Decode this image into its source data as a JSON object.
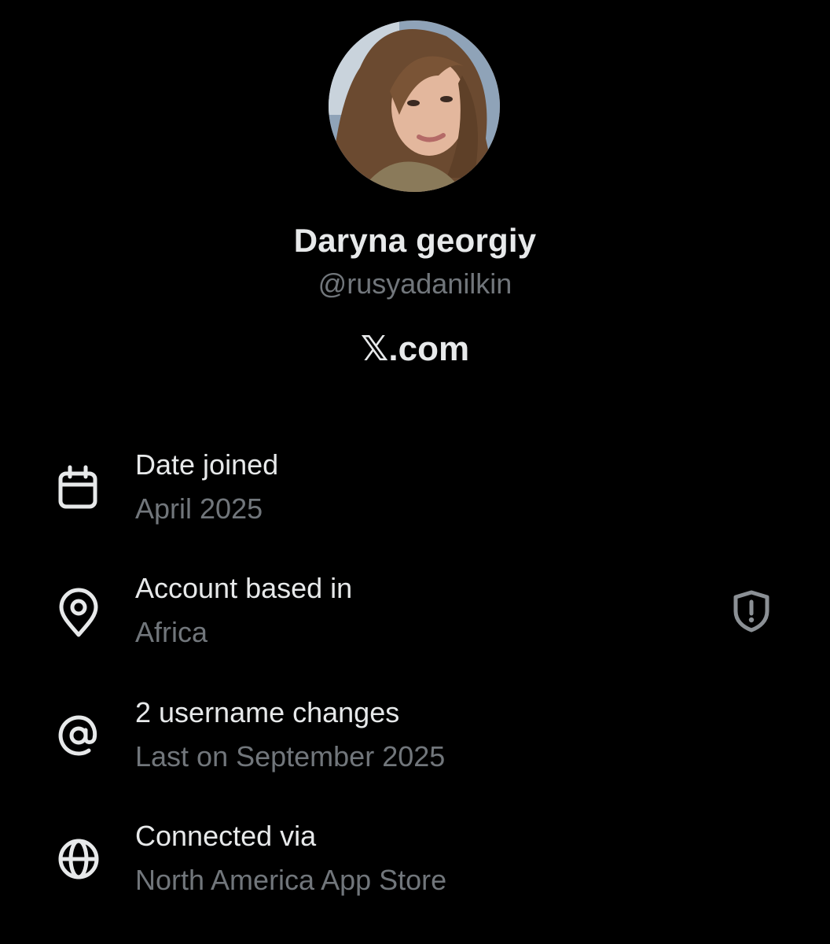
{
  "profile": {
    "display_name": "Daryna georgiy",
    "handle": "@rusyadanilkin",
    "site": "𝕏.com"
  },
  "details": {
    "items": [
      {
        "icon": "calendar-icon",
        "title": "Date joined",
        "value": "April 2025"
      },
      {
        "icon": "location-pin-icon",
        "title": "Account based in",
        "value": "Africa",
        "trailing_icon": "shield-alert-icon"
      },
      {
        "icon": "at-sign-icon",
        "title": "2 username changes",
        "value": "Last on September 2025"
      },
      {
        "icon": "globe-icon",
        "title": "Connected via",
        "value": "North America App Store"
      }
    ]
  },
  "colors": {
    "background": "#000000",
    "primary_text": "#e7e9ea",
    "secondary_text": "#71767b"
  }
}
